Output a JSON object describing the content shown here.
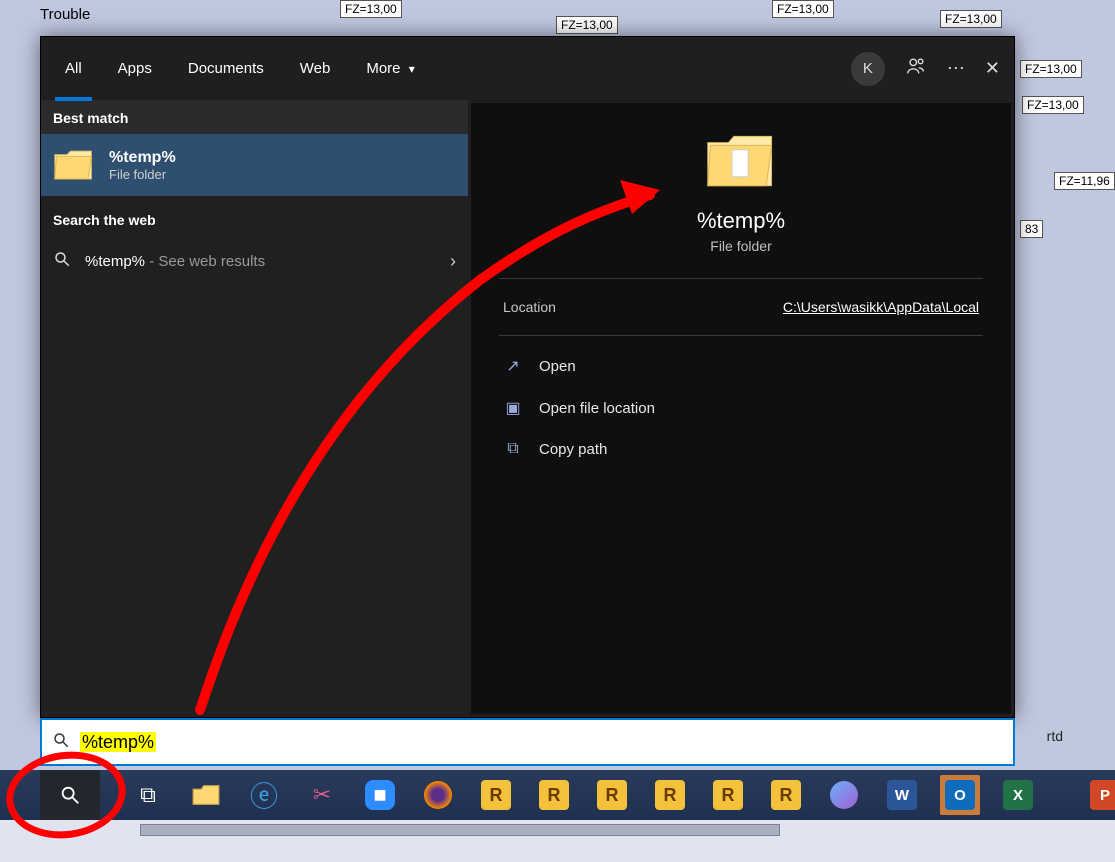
{
  "bg": {
    "word": "Trouble",
    "labels": [
      "FZ=13,00",
      "FZ=13,00",
      "FZ=13,00",
      "FZ=13,00",
      "FZ=13,00",
      "FZ=13,00",
      "FZ=11,96",
      "83"
    ]
  },
  "tabs": {
    "all": "All",
    "apps": "Apps",
    "documents": "Documents",
    "web": "Web",
    "more": "More",
    "avatar": "K"
  },
  "left": {
    "best_match": "Best match",
    "item_title": "%temp%",
    "item_subtitle": "File folder",
    "search_web": "Search the web",
    "web_query": "%temp%",
    "web_suffix": " - See web results"
  },
  "preview": {
    "title": "%temp%",
    "subtitle": "File folder",
    "location_label": "Location",
    "location_path": "C:\\Users\\wasikk\\AppData\\Local",
    "actions": {
      "open": "Open",
      "open_loc": "Open file location",
      "copy_path": "Copy path"
    }
  },
  "search_input": {
    "query": "%temp%"
  },
  "side_rtd": "rtd",
  "taskbar": {
    "r": "R",
    "word": "W",
    "excel": "X",
    "pp": "P",
    "outlook": "O"
  }
}
